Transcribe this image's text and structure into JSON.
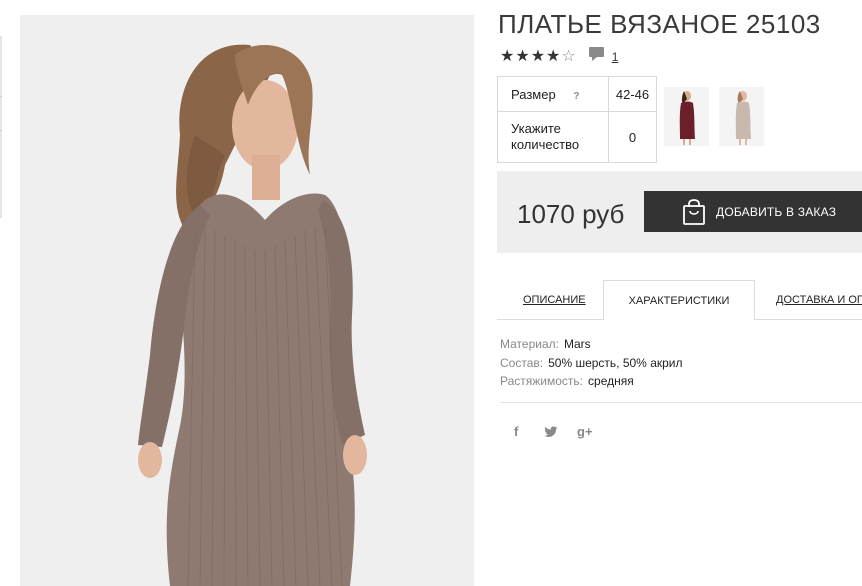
{
  "product": {
    "title": "ПЛАТЬЕ ВЯЗАНОЕ 25103",
    "rating": {
      "value": 4,
      "max": 5,
      "review_count": "1"
    },
    "options": {
      "size_label": "Размер",
      "size_help": "?",
      "size_value": "42-46",
      "qty_label_line1": "Укажите",
      "qty_label_line2": "количество",
      "qty_value": "0"
    },
    "price": "1070 руб",
    "add_to_cart_label": "ДОБАВИТЬ В ЗАКАЗ"
  },
  "colors": {
    "dress_mocha": "#8f7a72",
    "dress_burgundy": "#6b1f2a",
    "dress_beige": "#c9b8ad",
    "button_dark": "#333333",
    "buy_bar_bg": "#eeeeee"
  },
  "tabs": [
    {
      "label": "ОПИСАНИЕ",
      "active": false
    },
    {
      "label": "ХАРАКТЕРИСТИКИ",
      "active": true
    },
    {
      "label": "ДОСТАВКА И ОПЛАТА",
      "active": false
    }
  ],
  "specs": [
    {
      "label": "Материал:",
      "value": "Mars"
    },
    {
      "label": "Состав:",
      "value": "50% шерсть, 50% акрил"
    },
    {
      "label": "Растяжимость:",
      "value": "средняя"
    }
  ],
  "social": {
    "facebook": "f",
    "twitter": "twitter-icon",
    "googleplus": "g+"
  }
}
